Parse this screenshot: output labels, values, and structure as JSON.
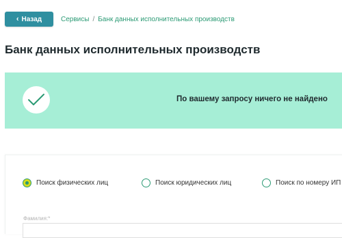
{
  "nav": {
    "back_label": "Назад",
    "back_icon": "chevron-left-icon"
  },
  "breadcrumb": {
    "items": [
      "Сервисы",
      "Банк данных исполнительных производств"
    ],
    "separator": "/"
  },
  "page": {
    "title": "Банк данных исполнительных производств"
  },
  "alert": {
    "icon": "check-icon",
    "message": "По вашему запросу ничего не найдено",
    "background": "#a6eed6"
  },
  "search": {
    "modes": [
      {
        "label": "Поиск физических лиц",
        "selected": true
      },
      {
        "label": "Поиск юридических лиц",
        "selected": false
      },
      {
        "label": "Поиск по номеру ИП",
        "selected": false
      }
    ],
    "surname_label": "Фамилия:*",
    "surname_value": ""
  },
  "colors": {
    "accent_green": "#2b9a74",
    "button_teal": "#2f8fa0",
    "radio_selected_fill": "#d4dc1c"
  }
}
